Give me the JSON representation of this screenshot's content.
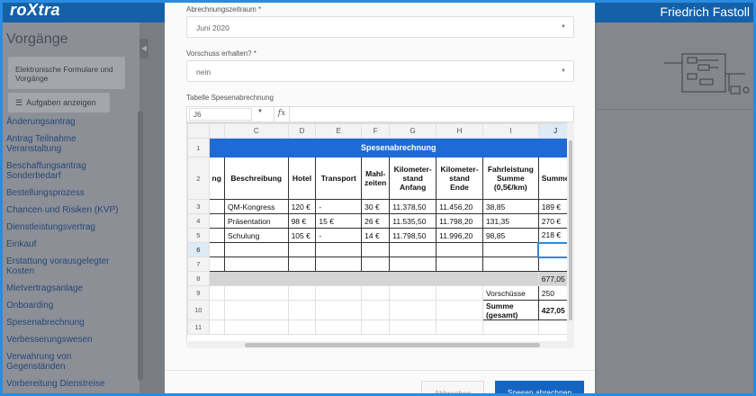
{
  "header": {
    "logo": "roXtra",
    "user": "Friedrich Fastoll"
  },
  "sidebar": {
    "title": "Vorgänge",
    "forms_button": "Elektronische Formulare und Vorgänge",
    "tasks_button": "Aufgaben anzeigen",
    "items": [
      "Änderungsantrag",
      "Antrag Teilnahme Veranstaltung",
      "Beschaffungsantrag Sonderbedarf",
      "Bestellungsprozess",
      "Chancen und Risiken (KVP)",
      "Dienstleistungsvertrag",
      "Einkauf",
      "Erstattung vorausgelegter Kosten",
      "Mietvertragsanlage",
      "Onboarding",
      "Spesenabrechnung",
      "Verbesserungswesen",
      "Verwahrung von Gegenständen",
      "Vorbereitung Dienstreise"
    ]
  },
  "form": {
    "period_label": "Abrechnungszeitraum *",
    "period_value": "Juni 2020",
    "advance_label": "Vorschuss erhalten? *",
    "advance_value": "nein",
    "table_label": "Tabelle Spesenabrechnung",
    "cell_ref": "J6",
    "fx": "fx"
  },
  "sheet": {
    "columns": [
      "",
      "C",
      "D",
      "E",
      "F",
      "G",
      "H",
      "I",
      "J"
    ],
    "title": "Spesenabrechnung",
    "headers": [
      "ng",
      "Beschreibung",
      "Hotel",
      "Transport",
      "Mahl-zeiten",
      "Kilometer-stand Anfang",
      "Kilometer-stand Ende",
      "Fahrleistung Summe (0,5€/km)",
      "Summe"
    ],
    "rows": [
      [
        "",
        "QM-Kongress",
        "120 €",
        "-",
        "30 €",
        "11.378,50",
        "11.456,20",
        "38,85",
        "189 €"
      ],
      [
        "",
        "Präsentation",
        "98 €",
        "15 €",
        "26 €",
        "11.535,50",
        "11.798,20",
        "131,35",
        "270 €"
      ],
      [
        "",
        "Schulung",
        "105 €",
        "-",
        "14 €",
        "11.798,50",
        "11.996,20",
        "98,85",
        "218 €"
      ]
    ],
    "row_numbers": [
      "1",
      "2",
      "3",
      "4",
      "5",
      "6",
      "7",
      "8",
      "9",
      "10",
      "11"
    ],
    "total": "677,05",
    "advance_label": "Vorschüsse",
    "advance_value": "250",
    "grand_label": "Summe (gesamt)",
    "grand_value": "427,05"
  },
  "footer": {
    "cancel": "Abbrechen",
    "submit": "Spesen abrechnen"
  },
  "colors": {
    "accent": "#1565c0",
    "sheet_title": "#1f6bd6",
    "topbar": "#1461a8"
  }
}
